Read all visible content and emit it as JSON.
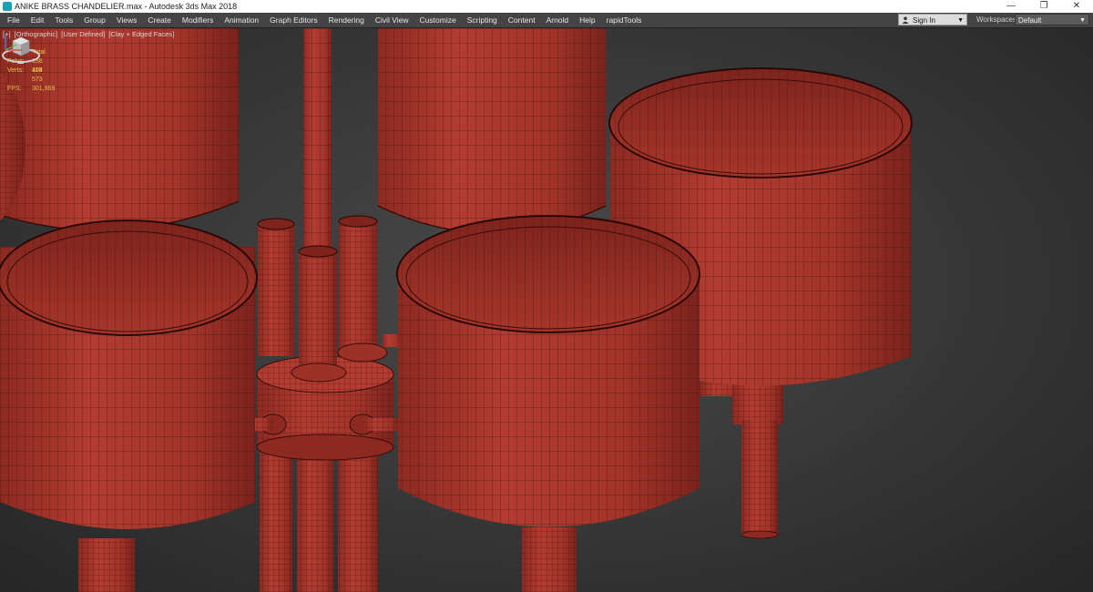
{
  "window": {
    "title": "ANIKE BRASS CHANDELIER.max - Autodesk 3ds Max 2018",
    "minimize": "—",
    "restore": "❐",
    "close": "✕"
  },
  "menubar": {
    "items": [
      "File",
      "Edit",
      "Tools",
      "Group",
      "Views",
      "Create",
      "Modifiers",
      "Animation",
      "Graph Editors",
      "Rendering",
      "Civil View",
      "Customize",
      "Scripting",
      "Content",
      "Arnold",
      "Help",
      "rapidTools"
    ],
    "signin_label": "Sign In",
    "workspaces_label": "Workspaces:",
    "workspace_value": "Default"
  },
  "viewport": {
    "labels": [
      "[+]",
      "[Orthographic]",
      "[User Defined]",
      "[Clay + Edged Faces]"
    ],
    "stats": {
      "header": "Total",
      "polys_label": "Polys:",
      "polys_value": "158 404",
      "verts_label": "Verts:",
      "verts_value": "119 573",
      "fps_label": "FPS:",
      "fps_value": "301,969"
    }
  },
  "colors": {
    "clay": "#a8362c",
    "clay_dark": "#7e241c",
    "wire": "#3a0c08",
    "stats_text": "#e8c24a"
  },
  "icons": {
    "app": "3ds-max-icon",
    "viewcube": "viewcube-icon",
    "signin": "person-icon",
    "axis": "axis-tripod-icon"
  }
}
